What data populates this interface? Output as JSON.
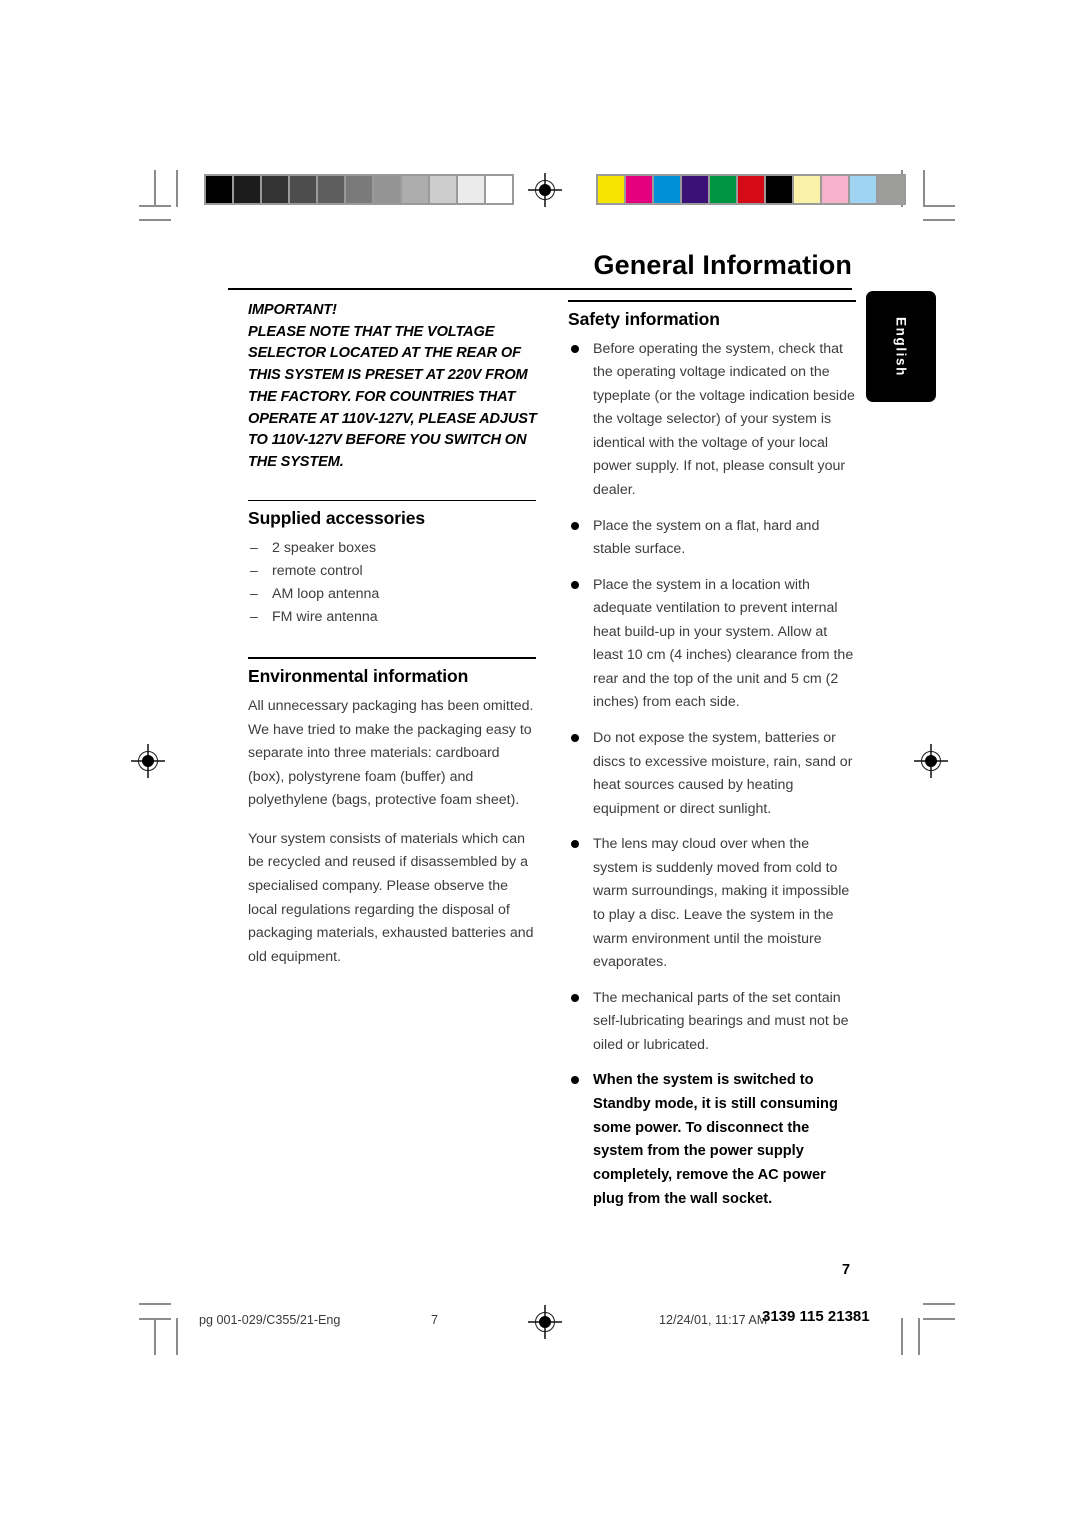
{
  "page": {
    "title": "General Information",
    "page_number": "7",
    "language_tab": "English"
  },
  "left_column": {
    "important": {
      "lines": [
        "IMPORTANT!",
        "PLEASE NOTE THAT THE VOLTAGE",
        "SELECTOR LOCATED AT THE REAR OF",
        "THIS SYSTEM IS PRESET AT 220V FROM",
        "THE FACTORY. FOR COUNTRIES THAT",
        "OPERATE AT 110V-127V, PLEASE ADJUST",
        "TO 110V-127V BEFORE YOU SWITCH ON",
        "THE SYSTEM."
      ]
    },
    "supplied_accessories": {
      "heading": "Supplied accessories",
      "items": [
        "2 speaker boxes",
        "remote control",
        "AM loop antenna",
        "FM wire antenna"
      ],
      "dash": "–"
    },
    "environmental_information": {
      "heading": "Environmental information",
      "paragraphs": [
        "All unnecessary packaging has been omitted. We have tried to make the packaging easy to separate into three materials: cardboard (box), polystyrene foam (buffer) and polyethylene (bags, protective foam sheet).",
        "Your system consists of materials which can be recycled and reused if disassembled by a specialised company. Please observe the local regulations regarding the disposal of packaging materials, exhausted batteries and old equipment."
      ]
    }
  },
  "right_column": {
    "safety_information": {
      "heading": "Safety information",
      "bullets": [
        {
          "text": "Before operating the system, check that the operating voltage indicated on the typeplate (or the voltage indication beside the voltage selector) of your system is identical with the voltage of your local power supply. If not, please consult your dealer.",
          "bold": false
        },
        {
          "text": "Place the system on a flat, hard and stable surface.",
          "bold": false
        },
        {
          "text": "Place the system in a location with adequate ventilation to prevent internal heat build-up in your system.  Allow at least 10 cm (4 inches) clearance from the rear and the top of the unit and 5 cm (2 inches) from each side.",
          "bold": false
        },
        {
          "text": "Do not expose the system, batteries or discs to excessive moisture, rain, sand or heat sources caused by heating equipment or direct sunlight.",
          "bold": false
        },
        {
          "text": "The lens may cloud over when the system is suddenly moved from cold to warm surroundings, making it impossible to play a disc. Leave the system in the warm environment until the moisture evaporates.",
          "bold": false
        },
        {
          "text": "The mechanical parts of the set contain self-lubricating bearings and must not be oiled or lubricated.",
          "bold": false
        },
        {
          "text": "When the system is switched to Standby mode, it is still consuming some power. To disconnect the system from the power supply completely, remove the AC power plug from the wall socket.",
          "bold": true
        }
      ]
    }
  },
  "footer": {
    "file_label": "pg 001-029/C355/21-Eng",
    "page_marker": "7",
    "timestamp": "12/24/01, 11:17 AM",
    "document_code": "3139 115 21381"
  },
  "print_marks": {
    "grayscale_bar": {
      "label": "grayscale-step-wedge",
      "swatches": [
        "#000000",
        "#1c1c1c",
        "#333333",
        "#4d4d4d",
        "#5e5e5e",
        "#7a7a7a",
        "#949494",
        "#adadad",
        "#cccccc",
        "#ebebeb",
        "#ffffff"
      ]
    },
    "color_bar": {
      "label": "color-control-bar",
      "swatches": [
        "#f6e500",
        "#e5007d",
        "#0090d7",
        "#3b1178",
        "#009540",
        "#d50a17",
        "#000000",
        "#faf2a8",
        "#f5b2ca",
        "#9fd4f2",
        "#9d9d9c"
      ]
    }
  }
}
